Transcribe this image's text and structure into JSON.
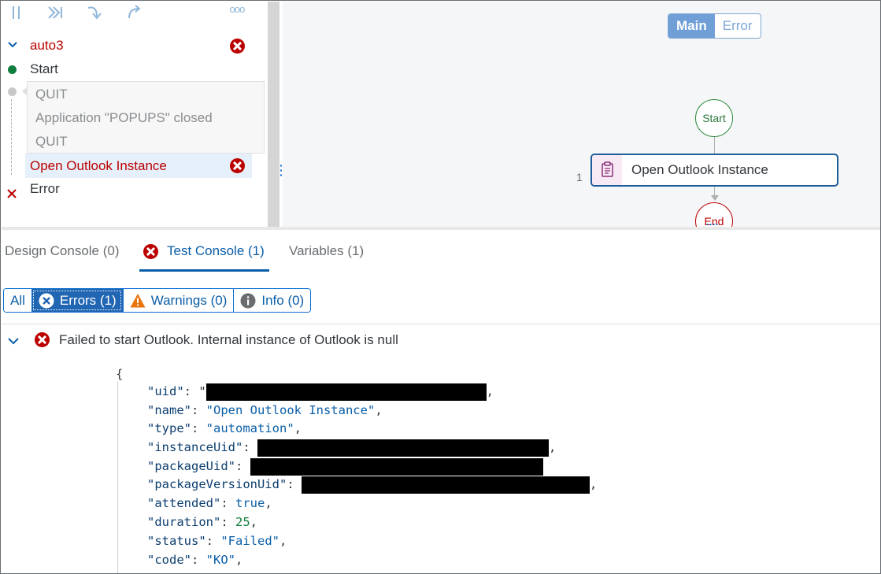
{
  "toolbar": {
    "pause_icon": "pause-icon",
    "step_over_icon": "skip-forward-icon",
    "step_into_icon": "step-into-icon",
    "step_out_icon": "redo-icon",
    "more_label": "ooo"
  },
  "tree": {
    "root_label": "auto3",
    "start_label": "Start",
    "sub_items": [
      "QUIT",
      "Application \"POPUPS\" closed",
      "QUIT"
    ],
    "selected_label": "Open Outlook Instance",
    "error_label": "Error"
  },
  "canvas": {
    "tabs": {
      "main": "Main",
      "error": "Error"
    },
    "start_node": "Start",
    "end_node": "End",
    "activity_label": "Open Outlook Instance",
    "activity_number": "1"
  },
  "console": {
    "tabs": {
      "design": "Design Console (0)",
      "test": "Test Console (1)",
      "variables": "Variables (1)"
    },
    "filters": {
      "all": "All",
      "errors": "Errors (1)",
      "warnings": "Warnings (0)",
      "info": "Info (0)"
    },
    "message": "Failed to start Outlook. Internal instance of Outlook is null",
    "json": {
      "open_brace": "{",
      "uid_key": "\"uid\"",
      "name_key": "\"name\"",
      "name_val": "\"Open Outlook Instance\"",
      "type_key": "\"type\"",
      "type_val": "\"automation\"",
      "instanceUid_key": "\"instanceUid\"",
      "packageUid_key": "\"packageUid\"",
      "packageVersionUid_key": "\"packageVersionUid\"",
      "attended_key": "\"attended\"",
      "attended_val": "true",
      "duration_key": "\"duration\"",
      "duration_val": "25",
      "status_key": "\"status\"",
      "status_val": "\"Failed\"",
      "code_key": "\"code\"",
      "code_val": "\"KO\""
    }
  },
  "colors": {
    "accent": "#0a6ed1",
    "error": "#bb0000",
    "success": "#2b8a3e",
    "warning": "#e9730c"
  }
}
